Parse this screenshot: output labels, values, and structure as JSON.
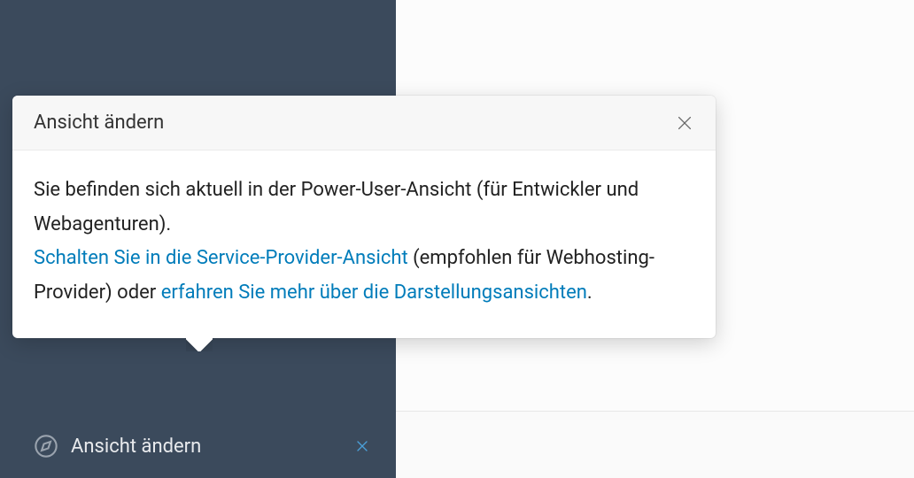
{
  "sidebar": {
    "change_view_label": "Ansicht ändern"
  },
  "popover": {
    "title": "Ansicht ändern",
    "body_text_1": "Sie befinden sich aktuell in der Power-User-Ansicht (für Entwickler und Webagenturen).",
    "link_1": "Schalten Sie in die Service-Provider-Ansicht",
    "body_text_2": " (empfohlen für Webhosting-Provider) oder ",
    "link_2": "erfahren Sie mehr über die Darstellungsansichten",
    "body_text_3": "."
  }
}
